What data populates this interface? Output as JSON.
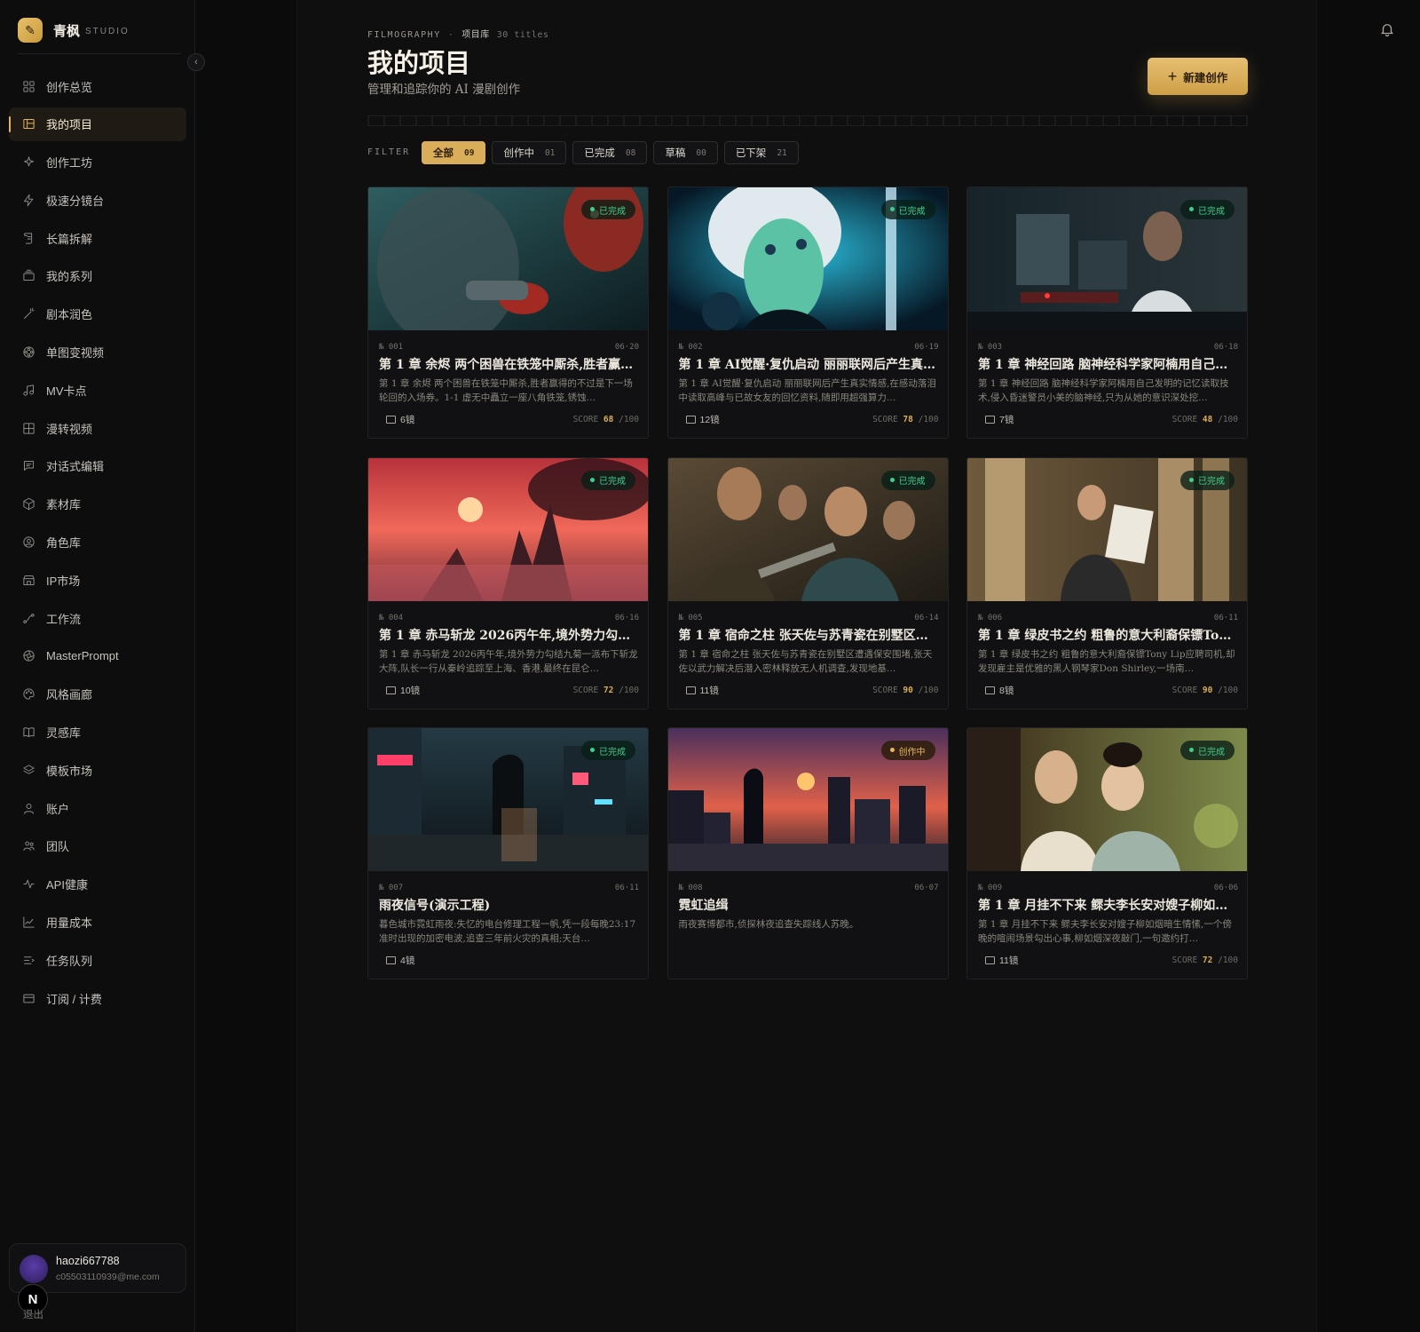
{
  "brand": {
    "name": "青枫",
    "sub": "STUDIO"
  },
  "sidebar": {
    "items": [
      {
        "label": "创作总览",
        "icon": "grid-icon"
      },
      {
        "label": "我的项目",
        "icon": "folders-icon",
        "active": true
      },
      {
        "label": "创作工坊",
        "icon": "sparkle-icon"
      },
      {
        "label": "极速分镜台",
        "icon": "bolt-icon"
      },
      {
        "label": "长篇拆解",
        "icon": "scroll-icon"
      },
      {
        "label": "我的系列",
        "icon": "stack-icon"
      },
      {
        "label": "剧本润色",
        "icon": "wand-icon"
      },
      {
        "label": "单图变视频",
        "icon": "film-reel-icon"
      },
      {
        "label": "MV卡点",
        "icon": "music-note-icon"
      },
      {
        "label": "漫转视频",
        "icon": "panels-icon"
      },
      {
        "label": "对话式编辑",
        "icon": "chat-icon"
      },
      {
        "label": "素材库",
        "icon": "cube-icon"
      },
      {
        "label": "角色库",
        "icon": "user-circle-icon"
      },
      {
        "label": "IP市场",
        "icon": "store-icon"
      },
      {
        "label": "工作流",
        "icon": "workflow-icon"
      },
      {
        "label": "MasterPrompt",
        "icon": "aperture-icon"
      },
      {
        "label": "风格画廊",
        "icon": "palette-icon"
      },
      {
        "label": "灵感库",
        "icon": "book-icon"
      },
      {
        "label": "模板市场",
        "icon": "layers-icon"
      },
      {
        "label": "账户",
        "icon": "user-icon"
      },
      {
        "label": "团队",
        "icon": "team-icon"
      },
      {
        "label": "API健康",
        "icon": "pulse-icon"
      },
      {
        "label": "用量成本",
        "icon": "chart-line-icon"
      },
      {
        "label": "任务队列",
        "icon": "queue-icon"
      },
      {
        "label": "订阅 / 计费",
        "icon": "card-icon"
      }
    ]
  },
  "user": {
    "name": "haozi667788",
    "email": "c05503110939@me.com",
    "logout": "退出",
    "badge": "N"
  },
  "header": {
    "crumb_section": "FILMOGRAPHY",
    "crumb_separator": "·",
    "crumb_library": "项目库",
    "crumb_count": "30 titles",
    "title": "我的项目",
    "subtitle": "管理和追踪你的 AI 漫剧创作",
    "new_button": "新建创作"
  },
  "filter": {
    "label": "FILTER",
    "chips": [
      {
        "label": "全部",
        "count": "09",
        "active": true
      },
      {
        "label": "创作中",
        "count": "01"
      },
      {
        "label": "已完成",
        "count": "08"
      },
      {
        "label": "草稿",
        "count": "00"
      },
      {
        "label": "已下架",
        "count": "21"
      }
    ]
  },
  "colors": {
    "accent": "#d9ad5a",
    "done": "#3ecf8e",
    "wip": "#e6b85c",
    "background": "#0b0b0c"
  },
  "projects": [
    {
      "id": "№ 001",
      "date": "06·20",
      "status": "已完成",
      "title": "第 1 章 余烬 两个困兽在铁笼中厮杀,胜者赢得…",
      "desc": "第 1 章 余烬 两个困兽在铁笼中厮杀,胜者赢得的不过是下一场轮回的入场券。1-1 虚无中矗立一座八角铁笼,锈蚀…",
      "shots": "6镜",
      "score_label": "SCORE",
      "score": "68",
      "score_max": "/100"
    },
    {
      "id": "№ 002",
      "date": "06·19",
      "status": "已完成",
      "title": "第 1 章 AI觉醒·复仇启动 丽丽联网后产生真…",
      "desc": "第 1 章 AI觉醒·复仇启动 丽丽联网后产生真实情感,在感动落泪中读取高峰与已故女友的回忆资料,随即用超强算力…",
      "shots": "12镜",
      "score_label": "SCORE",
      "score": "78",
      "score_max": "/100"
    },
    {
      "id": "№ 003",
      "date": "06·18",
      "status": "已完成",
      "title": "第 1 章 神经回路 脑神经科学家阿楠用自己发…",
      "desc": "第 1 章 神经回路 脑神经科学家阿楠用自己发明的记忆读取技术,侵入昏迷警员小美的脑神经,只为从她的意识深处挖…",
      "shots": "7镜",
      "score_label": "SCORE",
      "score": "48",
      "score_max": "/100"
    },
    {
      "id": "№ 004",
      "date": "06·16",
      "status": "已完成",
      "title": "第 1 章 赤马斩龙 2026丙午年,境外势力勾结…",
      "desc": "第 1 章 赤马斩龙 2026丙午年,境外势力勾结九菊一派布下斩龙大阵,队长一行从秦岭追踪至上海、香港,最终在昆仑…",
      "shots": "10镜",
      "score_label": "SCORE",
      "score": "72",
      "score_max": "/100"
    },
    {
      "id": "№ 005",
      "date": "06·14",
      "status": "已完成",
      "title": "第 1 章 宿命之柱 张天佐与苏青瓷在别墅区遭…",
      "desc": "第 1 章 宿命之柱 张天佐与苏青瓷在别墅区遭遇保安围堵,张天佐以武力解决后潜入密林释放无人机调查,发现地基…",
      "shots": "11镜",
      "score_label": "SCORE",
      "score": "90",
      "score_max": "/100"
    },
    {
      "id": "№ 006",
      "date": "06·11",
      "status": "已完成",
      "title": "第 1 章 绿皮书之约 粗鲁的意大利裔保镖Ton…",
      "desc": "第 1 章 绿皮书之约 粗鲁的意大利裔保镖Tony Lip应聘司机,却发现雇主是优雅的黑人钢琴家Don Shirley,一场南…",
      "shots": "8镜",
      "score_label": "SCORE",
      "score": "90",
      "score_max": "/100"
    },
    {
      "id": "№ 007",
      "date": "06·11",
      "status": "已完成",
      "title": "雨夜信号(演示工程)",
      "desc": "暮色城市霓虹雨夜:失忆的电台修理工程一帆,凭一段每晚23:17 准时出现的加密电波,追查三年前火灾的真相;天台…",
      "shots": "4镜"
    },
    {
      "id": "№ 008",
      "date": "06·07",
      "status": "创作中",
      "title": "霓虹追缉",
      "desc": "雨夜赛博都市,侦探林夜追查失踪线人苏晚。"
    },
    {
      "id": "№ 009",
      "date": "06·06",
      "status": "已完成",
      "title": "第 1 章 月挂不下来 鳏夫李长安对嫂子柳如烟…",
      "desc": "第 1 章 月挂不下来 鳏夫李长安对嫂子柳如烟暗生情愫,一个傍晚的喧闹场景勾出心事,柳如烟深夜敲门,一句邀约打…",
      "shots": "11镜",
      "score_label": "SCORE",
      "score": "72",
      "score_max": "/100"
    }
  ]
}
